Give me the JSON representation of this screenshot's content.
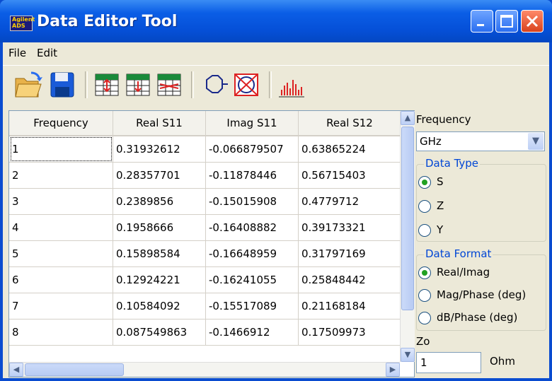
{
  "window": {
    "title": "Data Editor Tool",
    "icon_text_top": "Agilent",
    "icon_text_bottom": "ADS"
  },
  "menu": {
    "file": "File",
    "edit": "Edit"
  },
  "toolbar": {
    "icons": [
      "open-folder-icon",
      "save-icon",
      "insert-row-icon",
      "add-row-icon",
      "swap-rows-icon",
      "smith-chart-icon",
      "polar-plot-icon",
      "bar-chart-icon"
    ]
  },
  "grid": {
    "columns": [
      "Frequency",
      "Real S11",
      "Imag S11",
      "Real S12"
    ],
    "rows": [
      [
        "1",
        "0.31932612",
        "-0.066879507",
        "0.63865224"
      ],
      [
        "2",
        "0.28357701",
        "-0.11878446",
        "0.56715403"
      ],
      [
        "3",
        "0.2389856",
        "-0.15015908",
        "0.4779712"
      ],
      [
        "4",
        "0.1958666",
        "-0.16408882",
        "0.39173321"
      ],
      [
        "5",
        "0.15898584",
        "-0.16648959",
        "0.31797169"
      ],
      [
        "6",
        "0.12924221",
        "-0.16241055",
        "0.25848442"
      ],
      [
        "7",
        "0.10584092",
        "-0.15517089",
        "0.21168184"
      ],
      [
        "8",
        "0.087549863",
        "-0.1466912",
        "0.17509973"
      ]
    ]
  },
  "panel": {
    "frequency_label": "Frequency",
    "frequency_unit": "GHz",
    "data_type": {
      "title": "Data Type",
      "options": [
        "S",
        "Z",
        "Y"
      ],
      "selected": "S"
    },
    "data_format": {
      "title": "Data Format",
      "options": [
        "Real/Imag",
        "Mag/Phase (deg)",
        "dB/Phase (deg)"
      ],
      "selected": "Real/Imag"
    },
    "zo_label": "Zo",
    "zo_value": "1",
    "zo_unit": "Ohm"
  }
}
